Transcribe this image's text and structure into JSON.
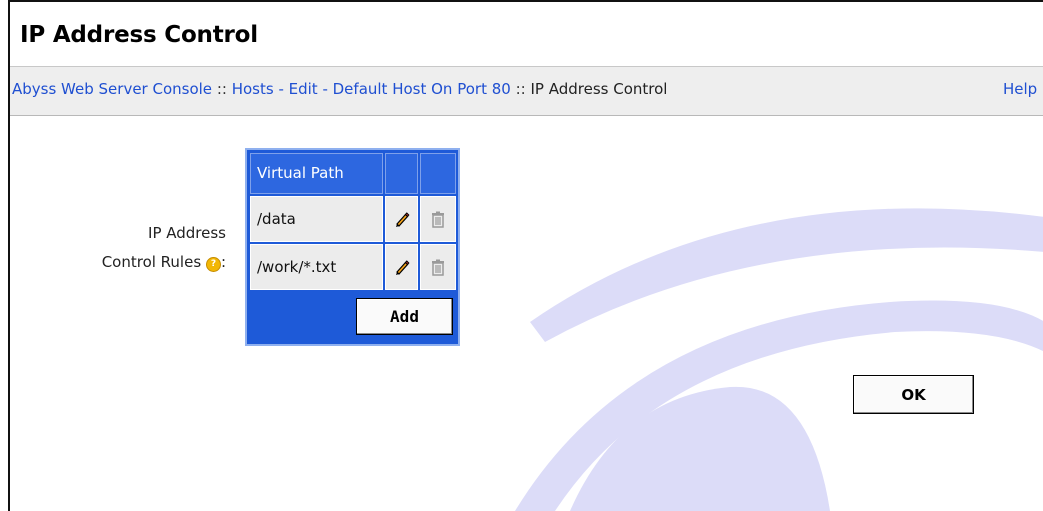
{
  "page": {
    "title": "IP Address Control"
  },
  "breadcrumb": {
    "items": [
      {
        "label": "Abyss Web Server Console"
      },
      {
        "label": "Hosts - Edit - Default Host On Port 80"
      },
      {
        "label": "IP Address Control"
      }
    ],
    "separator": "::",
    "help_label": "Help"
  },
  "form": {
    "rules_label_line1": "IP Address",
    "rules_label_line2": "Control Rules",
    "help_icon": "question-circle-icon"
  },
  "rules_table": {
    "columns": [
      "Virtual Path",
      "",
      ""
    ],
    "rows": [
      {
        "path": "/data",
        "edit_icon": "pencil-icon",
        "delete_icon": "trash-icon"
      },
      {
        "path": "/work/*.txt",
        "edit_icon": "pencil-icon",
        "delete_icon": "trash-icon"
      }
    ],
    "add_label": "Add"
  },
  "actions": {
    "ok_label": "OK"
  },
  "colors": {
    "table_blue": "#1e5ad8",
    "link_blue": "#1f4fd1",
    "watermark": "#dcdcf8"
  }
}
